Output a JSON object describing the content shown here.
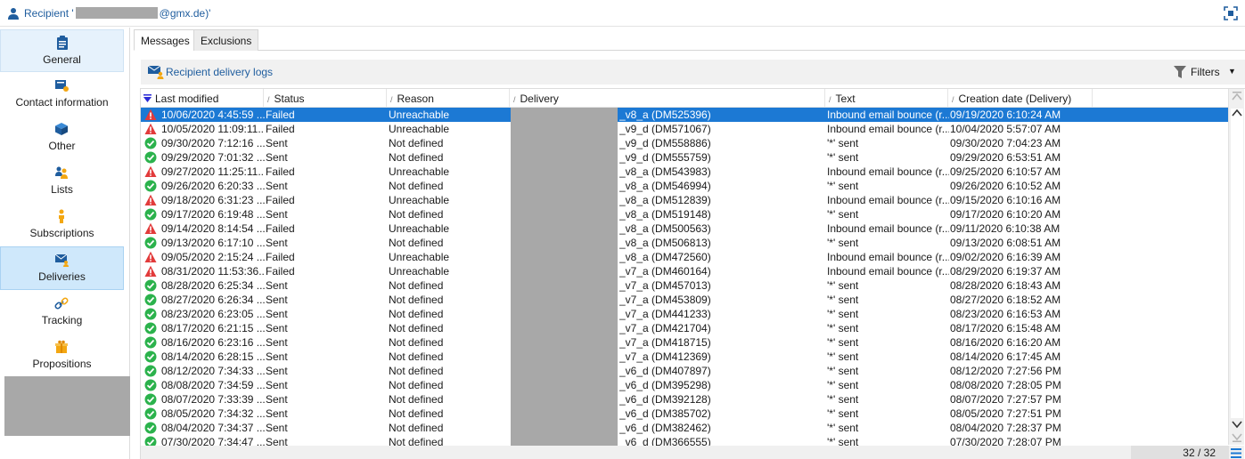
{
  "titlebar": {
    "prefix": "Recipient '",
    "suffix": "@gmx.de)'"
  },
  "nav": [
    {
      "label": "General",
      "icon": "clipboard-icon",
      "active": false,
      "highlight": true
    },
    {
      "label": "Contact information",
      "icon": "contact-card-icon",
      "active": false
    },
    {
      "label": "Other",
      "icon": "cube-icon",
      "active": false
    },
    {
      "label": "Lists",
      "icon": "users-group-icon",
      "active": false
    },
    {
      "label": "Subscriptions",
      "icon": "person-icon",
      "active": false
    },
    {
      "label": "Deliveries",
      "icon": "envelope-person-icon",
      "active": true
    },
    {
      "label": "Tracking",
      "icon": "link-icon",
      "active": false
    },
    {
      "label": "Propositions",
      "icon": "gift-icon",
      "active": false
    }
  ],
  "tabs": [
    {
      "label": "Messages",
      "active": true
    },
    {
      "label": "Exclusions",
      "active": false
    }
  ],
  "toolbar": {
    "logs_label": "Recipient delivery logs",
    "filters_label": "Filters"
  },
  "columns": {
    "last_modified": "Last modified",
    "status": "Status",
    "reason": "Reason",
    "delivery": "Delivery",
    "text": "Text",
    "created": "Creation date (Delivery)"
  },
  "rows": [
    {
      "ok": false,
      "selected": true,
      "mod": "10/06/2020 4:45:59 ...",
      "status": "Failed",
      "reason": "Unreachable",
      "delivery": "_v8_a (DM525396)",
      "text": "Inbound email bounce (r...",
      "created": "09/19/2020 6:10:24 AM"
    },
    {
      "ok": false,
      "selected": false,
      "mod": "10/05/2020 11:09:11...",
      "status": "Failed",
      "reason": "Unreachable",
      "delivery": "_v9_d (DM571067)",
      "text": "Inbound email bounce (r...",
      "created": "10/04/2020 5:57:07 AM"
    },
    {
      "ok": true,
      "selected": false,
      "mod": "09/30/2020 7:12:16 ...",
      "status": "Sent",
      "reason": "Not defined",
      "delivery": "_v9_d (DM558886)",
      "text": "'*' sent",
      "created": "09/30/2020 7:04:23 AM"
    },
    {
      "ok": true,
      "selected": false,
      "mod": "09/29/2020 7:01:32 ...",
      "status": "Sent",
      "reason": "Not defined",
      "delivery": "_v9_d (DM555759)",
      "text": "'*' sent",
      "created": "09/29/2020 6:53:51 AM"
    },
    {
      "ok": false,
      "selected": false,
      "mod": "09/27/2020 11:25:11...",
      "status": "Failed",
      "reason": "Unreachable",
      "delivery": "_v8_a (DM543983)",
      "text": "Inbound email bounce (r...",
      "created": "09/25/2020 6:10:57 AM"
    },
    {
      "ok": true,
      "selected": false,
      "mod": "09/26/2020 6:20:33 ...",
      "status": "Sent",
      "reason": "Not defined",
      "delivery": "_v8_a (DM546994)",
      "text": "'*' sent",
      "created": "09/26/2020 6:10:52 AM"
    },
    {
      "ok": false,
      "selected": false,
      "mod": "09/18/2020 6:31:23 ...",
      "status": "Failed",
      "reason": "Unreachable",
      "delivery": "_v8_a (DM512839)",
      "text": "Inbound email bounce (r...",
      "created": "09/15/2020 6:10:16 AM"
    },
    {
      "ok": true,
      "selected": false,
      "mod": "09/17/2020 6:19:48 ...",
      "status": "Sent",
      "reason": "Not defined",
      "delivery": "_v8_a (DM519148)",
      "text": "'*' sent",
      "created": "09/17/2020 6:10:20 AM"
    },
    {
      "ok": false,
      "selected": false,
      "mod": "09/14/2020 8:14:54 ...",
      "status": "Failed",
      "reason": "Unreachable",
      "delivery": "_v8_a (DM500563)",
      "text": "Inbound email bounce (r...",
      "created": "09/11/2020 6:10:38 AM"
    },
    {
      "ok": true,
      "selected": false,
      "mod": "09/13/2020 6:17:10 ...",
      "status": "Sent",
      "reason": "Not defined",
      "delivery": "_v8_a (DM506813)",
      "text": "'*' sent",
      "created": "09/13/2020 6:08:51 AM"
    },
    {
      "ok": false,
      "selected": false,
      "mod": "09/05/2020 2:15:24 ...",
      "status": "Failed",
      "reason": "Unreachable",
      "delivery": "_v8_a (DM472560)",
      "text": "Inbound email bounce (r...",
      "created": "09/02/2020 6:16:39 AM"
    },
    {
      "ok": false,
      "selected": false,
      "mod": "08/31/2020 11:53:36...",
      "status": "Failed",
      "reason": "Unreachable",
      "delivery": "_v7_a (DM460164)",
      "text": "Inbound email bounce (r...",
      "created": "08/29/2020 6:19:37 AM"
    },
    {
      "ok": true,
      "selected": false,
      "mod": "08/28/2020 6:25:34 ...",
      "status": "Sent",
      "reason": "Not defined",
      "delivery": "_v7_a (DM457013)",
      "text": "'*' sent",
      "created": "08/28/2020 6:18:43 AM"
    },
    {
      "ok": true,
      "selected": false,
      "mod": "08/27/2020 6:26:34 ...",
      "status": "Sent",
      "reason": "Not defined",
      "delivery": "_v7_a (DM453809)",
      "text": "'*' sent",
      "created": "08/27/2020 6:18:52 AM"
    },
    {
      "ok": true,
      "selected": false,
      "mod": "08/23/2020 6:23:05 ...",
      "status": "Sent",
      "reason": "Not defined",
      "delivery": "_v7_a (DM441233)",
      "text": "'*' sent",
      "created": "08/23/2020 6:16:53 AM"
    },
    {
      "ok": true,
      "selected": false,
      "mod": "08/17/2020 6:21:15 ...",
      "status": "Sent",
      "reason": "Not defined",
      "delivery": "_v7_a (DM421704)",
      "text": "'*' sent",
      "created": "08/17/2020 6:15:48 AM"
    },
    {
      "ok": true,
      "selected": false,
      "mod": "08/16/2020 6:23:16 ...",
      "status": "Sent",
      "reason": "Not defined",
      "delivery": "_v7_a (DM418715)",
      "text": "'*' sent",
      "created": "08/16/2020 6:16:20 AM"
    },
    {
      "ok": true,
      "selected": false,
      "mod": "08/14/2020 6:28:15 ...",
      "status": "Sent",
      "reason": "Not defined",
      "delivery": "_v7_a (DM412369)",
      "text": "'*' sent",
      "created": "08/14/2020 6:17:45 AM"
    },
    {
      "ok": true,
      "selected": false,
      "mod": "08/12/2020 7:34:33 ...",
      "status": "Sent",
      "reason": "Not defined",
      "delivery": "_v6_d (DM407897)",
      "text": "'*' sent",
      "created": "08/12/2020 7:27:56 PM"
    },
    {
      "ok": true,
      "selected": false,
      "mod": "08/08/2020 7:34:59 ...",
      "status": "Sent",
      "reason": "Not defined",
      "delivery": "_v6_d (DM395298)",
      "text": "'*' sent",
      "created": "08/08/2020 7:28:05 PM"
    },
    {
      "ok": true,
      "selected": false,
      "mod": "08/07/2020 7:33:39 ...",
      "status": "Sent",
      "reason": "Not defined",
      "delivery": "_v6_d (DM392128)",
      "text": "'*' sent",
      "created": "08/07/2020 7:27:57 PM"
    },
    {
      "ok": true,
      "selected": false,
      "mod": "08/05/2020 7:34:32 ...",
      "status": "Sent",
      "reason": "Not defined",
      "delivery": "_v6_d (DM385702)",
      "text": "'*' sent",
      "created": "08/05/2020 7:27:51 PM"
    },
    {
      "ok": true,
      "selected": false,
      "mod": "08/04/2020 7:34:37 ...",
      "status": "Sent",
      "reason": "Not defined",
      "delivery": "_v6_d (DM382462)",
      "text": "'*' sent",
      "created": "08/04/2020 7:28:37 PM"
    },
    {
      "ok": true,
      "selected": false,
      "mod": "07/30/2020 7:34:47 ...",
      "status": "Sent",
      "reason": "Not defined",
      "delivery": "_v6_d (DM366555)",
      "text": "'*' sent",
      "created": "07/30/2020 7:28:07 PM"
    }
  ],
  "footer": {
    "count": "32 / 32"
  },
  "colors": {
    "accent": "#1f5d9e",
    "selected_row": "#1c79d4",
    "nav_active": "#cfe8fb",
    "ok_green": "#2bb24c",
    "fail_red": "#e23b3b"
  }
}
